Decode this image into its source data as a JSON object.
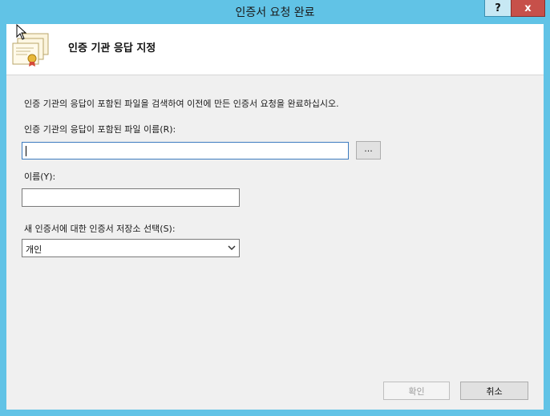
{
  "window": {
    "title": "인증서 요청 완료",
    "help_label": "?",
    "close_label": "x"
  },
  "header": {
    "title": "인증 기관 응답 지정",
    "icon": "certificate-icon"
  },
  "description": "인증 기관의 응답이 포함된 파일을 검색하여 이전에 만든 인증서 요청을 완료하십시오.",
  "file_field": {
    "label": "인증 기관의 응답이 포함된 파일 이름(R):",
    "value": "",
    "browse_label": "..."
  },
  "name_field": {
    "label": "이름(Y):",
    "value": ""
  },
  "store_field": {
    "label": "새 인증서에 대한 인증서 저장소 선택(S):",
    "selected": "개인"
  },
  "buttons": {
    "ok_label": "확인",
    "cancel_label": "취소"
  }
}
